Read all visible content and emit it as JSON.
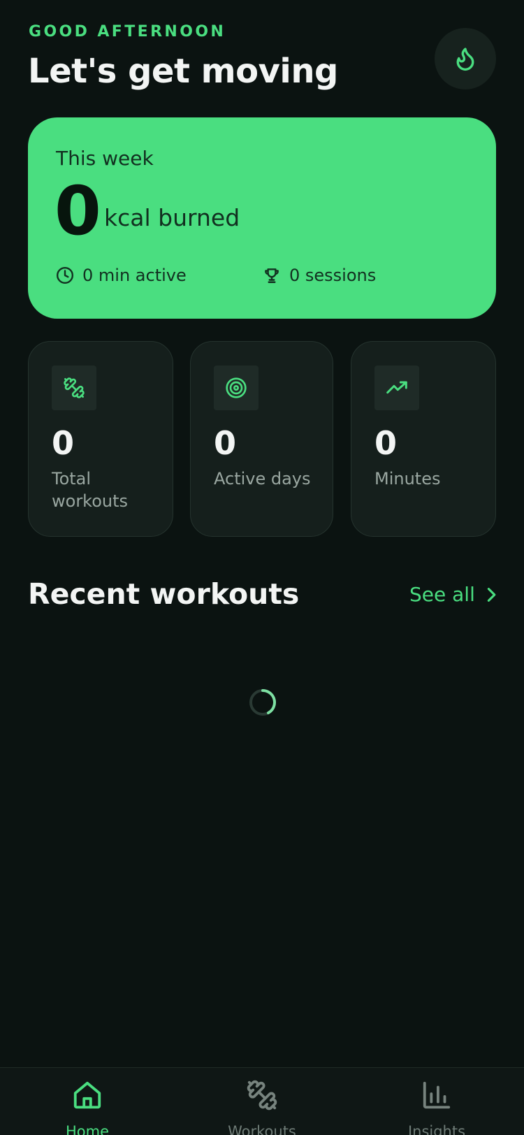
{
  "header": {
    "greeting": "GOOD AFTERNOON",
    "headline": "Let's get moving",
    "action_icon": "flame-icon"
  },
  "week_card": {
    "label": "This week",
    "kcal_value": "0",
    "kcal_unit": "kcal burned",
    "active_minutes": "0 min active",
    "sessions": "0 sessions"
  },
  "stats": [
    {
      "icon": "dumbbell-icon",
      "value": "0",
      "label": "Total workouts"
    },
    {
      "icon": "target-icon",
      "value": "0",
      "label": "Active days"
    },
    {
      "icon": "trending-up-icon",
      "value": "0",
      "label": "Minutes"
    }
  ],
  "recent": {
    "title": "Recent workouts",
    "see_all": "See all"
  },
  "nav": {
    "items": [
      {
        "label": "Home",
        "icon": "home-icon",
        "active": true
      },
      {
        "label": "Workouts",
        "icon": "dumbbell-icon",
        "active": false
      },
      {
        "label": "Insights",
        "icon": "bar-chart-icon",
        "active": false
      }
    ]
  },
  "colors": {
    "accent": "#4ade80",
    "background": "#0b1311",
    "card": "#151f1c"
  }
}
